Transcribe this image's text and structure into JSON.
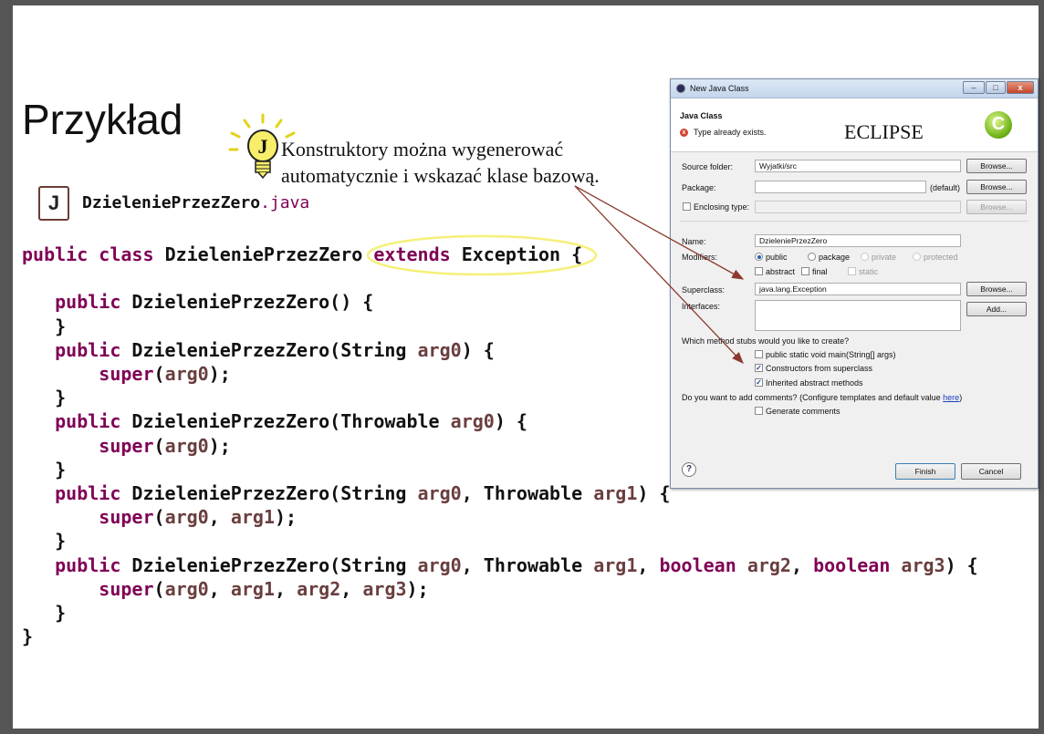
{
  "slide": {
    "title": "Przykład",
    "callout_line1": "Konstruktory można wygenerować",
    "callout_line2": "automatycznie  i wskazać klase bazową.",
    "file_icon_letter": "J",
    "file_name": "DzieleniePrzezZero",
    "file_ext": ".java",
    "highlight_color": "#f5f07a",
    "arrow_color": "#8b3a2e"
  },
  "code": {
    "kw_public": "public",
    "kw_class": "class",
    "kw_extends": "extends",
    "kw_super": "super",
    "kw_boolean": "boolean",
    "class_name": "DzieleniePrzezZero",
    "base_class": "Exception",
    "type_string": "String",
    "type_throwable": "Throwable",
    "arg0": "arg0",
    "arg1": "arg1",
    "arg2": "arg2",
    "arg3": "arg3",
    "keyword_color": "#7f0055",
    "var_color": "#6a3e3e"
  },
  "dialog": {
    "window_title": "New Java Class",
    "header_title": "Java Class",
    "error_message": "Type already exists.",
    "tool_label": "ECLIPSE",
    "source_folder_label": "Source folder:",
    "source_folder_value": "Wyjatki/src",
    "package_label": "Package:",
    "package_value": "",
    "package_default": "(default)",
    "enclosing_label": "Enclosing type:",
    "browse_label": "Browse...",
    "name_label": "Name:",
    "name_value": "DzieleniePrzezZero",
    "modifiers_label": "Modifiers:",
    "mod_public": "public",
    "mod_package": "package",
    "mod_private": "private",
    "mod_protected": "protected",
    "mod_abstract": "abstract",
    "mod_final": "final",
    "mod_static": "static",
    "superclass_label": "Superclass:",
    "superclass_value": "java.lang.Exception",
    "interfaces_label": "Interfaces:",
    "add_label": "Add...",
    "stubs_question": "Which method stubs would you like to create?",
    "stub_main": "public static void main(String[] args)",
    "stub_ctors": "Constructors from superclass",
    "stub_abstract": "Inherited abstract methods",
    "comments_question": "Do you want to add comments? (Configure templates and default value ",
    "comments_link": "here",
    "comments_close": ")",
    "generate_comments": "Generate comments",
    "help_symbol": "?",
    "finish_label": "Finish",
    "cancel_label": "Cancel",
    "minimize_symbol": "–",
    "maximize_symbol": "□",
    "close_symbol": "x",
    "checkmark": "✓",
    "logo_letter": "C"
  }
}
